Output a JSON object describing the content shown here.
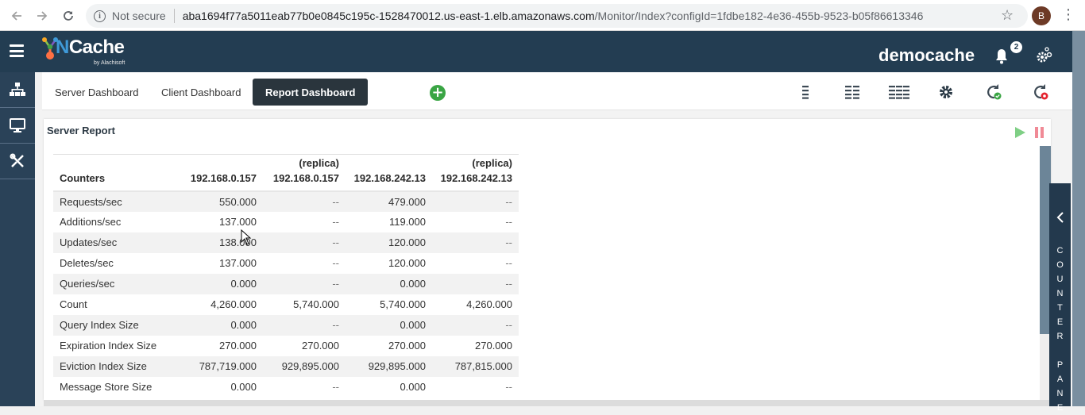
{
  "browser": {
    "security_label": "Not secure",
    "url_host": "aba1694f77a5011eab77b0e0845c195c-1528470012.us-east-1.elb.amazonaws.com",
    "url_path": "/Monitor/Index?configId=1fdbe182-4e36-455b-9523-b05f86613346",
    "profile_initial": "B"
  },
  "header": {
    "logo_text_n": "N",
    "logo_text_rest": "Cache",
    "logo_byline": "by Alachisoft",
    "cache_name": "democache",
    "notification_count": "2"
  },
  "sidebar": {
    "items": [
      {
        "icon": "topology-icon"
      },
      {
        "icon": "monitor-icon"
      },
      {
        "icon": "tools-icon"
      }
    ]
  },
  "tabs": [
    {
      "label": "Server Dashboard",
      "active": false
    },
    {
      "label": "Client Dashboard",
      "active": false
    },
    {
      "label": "Report Dashboard",
      "active": true
    }
  ],
  "toolbar": {
    "icons": [
      "one-column-layout-icon",
      "two-column-layout-icon",
      "three-column-layout-icon",
      "settings-icon",
      "refresh-success-icon",
      "refresh-error-icon"
    ]
  },
  "report": {
    "title": "Server Report",
    "columns": [
      {
        "sub": "",
        "label": "Counters"
      },
      {
        "sub": "",
        "label": "192.168.0.157"
      },
      {
        "sub": "(replica)",
        "label": "192.168.0.157"
      },
      {
        "sub": "",
        "label": "192.168.242.13"
      },
      {
        "sub": "(replica)",
        "label": "192.168.242.13"
      }
    ],
    "rows": [
      [
        "Requests/sec",
        "550.000",
        "--",
        "479.000",
        "--"
      ],
      [
        "Additions/sec",
        "137.000",
        "--",
        "119.000",
        "--"
      ],
      [
        "Updates/sec",
        "138.000",
        "--",
        "120.000",
        "--"
      ],
      [
        "Deletes/sec",
        "137.000",
        "--",
        "120.000",
        "--"
      ],
      [
        "Queries/sec",
        "0.000",
        "--",
        "0.000",
        "--"
      ],
      [
        "Count",
        "4,260.000",
        "5,740.000",
        "5,740.000",
        "4,260.000"
      ],
      [
        "Query Index Size",
        "0.000",
        "--",
        "0.000",
        "--"
      ],
      [
        "Expiration Index Size",
        "270.000",
        "270.000",
        "270.000",
        "270.000"
      ],
      [
        "Eviction Index Size",
        "787,719.000",
        "929,895.000",
        "929,895.000",
        "787,815.000"
      ],
      [
        "Message Store Size",
        "0.000",
        "--",
        "0.000",
        "--"
      ]
    ]
  },
  "counter_panel": {
    "label_line1": "COUNTER",
    "label_line2": "PANE"
  },
  "colors": {
    "header_bg": "#233d52",
    "active_tab_bg": "#2a353d",
    "add_green": "#3aa544",
    "play_green": "#7fcf85",
    "pause_red": "#f08a96"
  }
}
